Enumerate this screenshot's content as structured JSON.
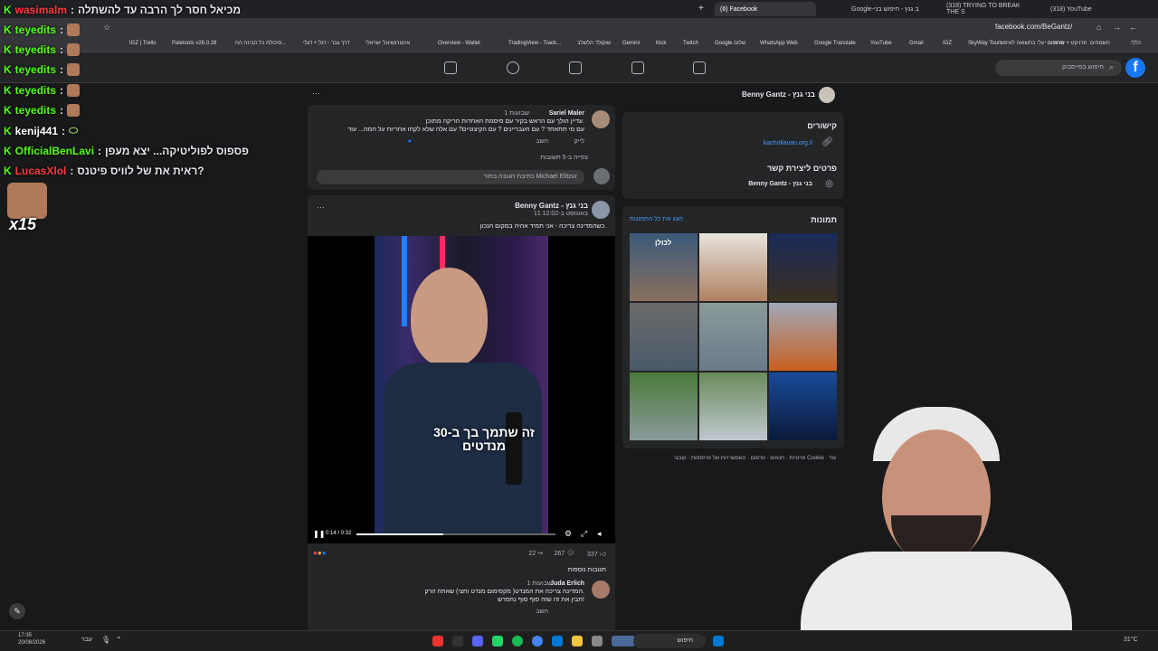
{
  "browser": {
    "tabs": [
      {
        "label": "(6) Facebook",
        "active": true
      },
      {
        "label": "Google-ב גנץ - חיפוש בני",
        "active": false
      },
      {
        "label": "(318) TRYING TO BREAK THE S",
        "active": false
      },
      {
        "label": "(318) YouTube",
        "active": false
      }
    ],
    "url": "facebook.com/BeGantz/",
    "bookmarks": [
      "כללי",
      "השמחים",
      "פרויקט + שרותים",
      "סחורות יעלי בתשואה לאיפור",
      "SkyWay Tours",
      "IGZ",
      "Gmail",
      "YouTube",
      "Google Translate",
      "WhatsApp Web",
      "Google שלום",
      "Twitch",
      "Kick",
      "Gemini",
      "שוקולד הלשלב",
      "TradingView - Track...",
      "Overview - Wallet",
      "אינטרנשיונל ישראלי",
      "דרך גבר - דגל + דגלי",
      "סיכולת כל הבינה הח...",
      "Paletools v26.0.28",
      "IGZ | Trello"
    ]
  },
  "stream_chat": [
    {
      "user": "wasimalm",
      "text": "מכיאל חסר לך הרבה עד להשתלה",
      "color": "#ff3b3b"
    },
    {
      "user": "teyedits",
      "text": "",
      "color": "#53fc18"
    },
    {
      "user": "teyedits",
      "text": "",
      "color": "#53fc18"
    },
    {
      "user": "teyedits",
      "text": "",
      "color": "#53fc18"
    },
    {
      "user": "teyedits",
      "text": "",
      "color": "#53fc18"
    },
    {
      "user": "teyedits",
      "text": "",
      "color": "#53fc18"
    },
    {
      "user": "kenij441",
      "text": "",
      "color": "#ffffff"
    },
    {
      "user": "OfficialBenLavi",
      "text": "פספוס לפוליטיקה... יצא מעפן",
      "color": "#53fc18"
    },
    {
      "user": "LucasXlol",
      "text": "ראית את של לוויס פיטנס?",
      "color": "#ff3b3b"
    }
  ],
  "stream_badge": "x15",
  "facebook": {
    "search_placeholder": "חיפוש בפייסבוק",
    "page_name": "Benny Gantz - בני גנץ",
    "comment1": {
      "author": "Sariel Maler",
      "time": "1 שבועות",
      "text1": "עדיין הולך עם הראש בקיר עם סיסמת האחדות הריקה מתוכן.",
      "text2": "עם מי תתאחד ? עם העבריינים ? עם הקיצוניים? עם אלה שלא לקחו אחריות על המח... עוד",
      "like": "לייק",
      "reply": "השב",
      "view_replies": "צפייה ב-5 תשובות"
    },
    "comment_input": "כתיבת תגובה בתור Michael Elitzur",
    "post": {
      "author": "Benny Gantz - בני גנץ",
      "date": "11 באוגוסט ב-12:02",
      "text": "כשהמדינה צריכה - אני תמיד אהיה במקום הנכון.",
      "video_caption": "זה שתמך בך ב-30 מנדטים",
      "video_time": "0:14 / 0:32",
      "reactions": "337",
      "comments": "267",
      "shares": "22",
      "more_comments": "תגובות נוספות"
    },
    "comment2": {
      "author": "Juda Erlich",
      "time": "1 שבועות",
      "text1": "המדינה צריכה את המנדט( מקסימום מנדט וחצי) שאתה זורק.",
      "text2": "תבין את זה שזה סוף סוף נתפרש!",
      "reply": "השב"
    },
    "links_title": "קישורים",
    "link_url": "kachollavan.org.il",
    "contact_title": "פרטים ליצירת קשר",
    "contact_value": "Benny Gantz - בני גנץ",
    "photos_title": "תמונות",
    "photos_link": "הצג את כל התמונות",
    "photo_text": "לכולן",
    "footer": "פרטיות · תנאים · פרסום · האפשרויות של פרסומות · קובצי Cookie · עוד"
  },
  "taskbar": {
    "time": "17:35",
    "date": "20/08/2026",
    "search": "חיפוש",
    "weather": "31°C",
    "lang": "עבר"
  }
}
